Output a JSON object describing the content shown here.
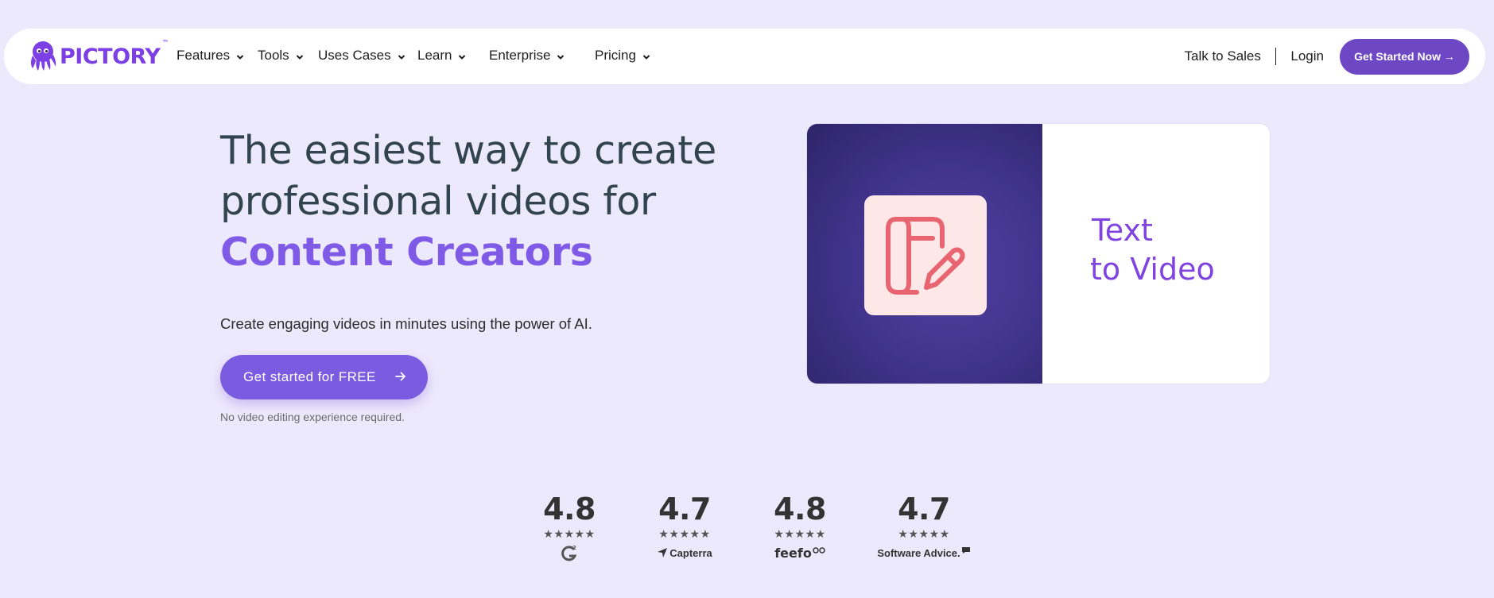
{
  "nav": {
    "logo_text": "PICTORY",
    "logo_tm": "™",
    "menu": [
      {
        "label": "Features"
      },
      {
        "label": "Tools"
      },
      {
        "label": "Uses Cases"
      },
      {
        "label": "Learn"
      },
      {
        "label": "Enterprise"
      },
      {
        "label": "Pricing"
      }
    ],
    "talk_to_sales": "Talk to Sales",
    "login": "Login",
    "cta": "Get Started Now →"
  },
  "hero": {
    "title_line1": "The easiest way to create",
    "title_line2": "professional videos for",
    "title_highlight": "Content Creators",
    "subtitle": "Create engaging videos in minutes using the power of AI.",
    "cta": "Get started for FREE",
    "note": "No video editing experience required."
  },
  "video_card": {
    "line1": "Text",
    "line2": "to Video",
    "icon": "document-edit-icon"
  },
  "ratings": [
    {
      "score": "4.8",
      "stars": "★★★★★",
      "brand": "G2"
    },
    {
      "score": "4.7",
      "stars": "★★★★★",
      "brand": "Capterra"
    },
    {
      "score": "4.8",
      "stars": "★★★★★",
      "brand": "feefo"
    },
    {
      "score": "4.7",
      "stars": "★★★★★",
      "brand": "Software Advice."
    }
  ],
  "colors": {
    "background": "#ede9fd",
    "brand_purple": "#7b3fe4",
    "cta_purple": "#6e47c5",
    "heading": "#314450",
    "highlight": "#7f5ae6"
  }
}
